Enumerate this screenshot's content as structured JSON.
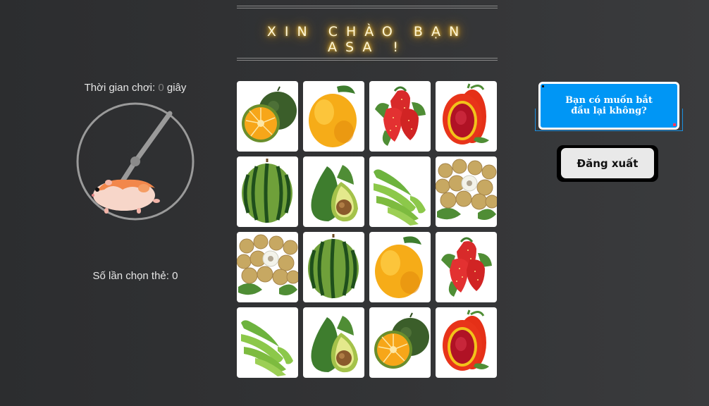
{
  "header": {
    "title": "XIN CHÀO BẠN ASA !"
  },
  "stats": {
    "timer_prefix": "Thời gian chơi: ",
    "timer_value": "0",
    "timer_unit": " giây",
    "clicks_prefix": "Số lần chọn thẻ: ",
    "clicks_value": "0"
  },
  "board": {
    "cards": [
      "orange-fruit-icon",
      "mango-fruit-icon",
      "strawberry-fruit-icon",
      "gac-fruit-icon",
      "watermelon-fruit-icon",
      "avocado-fruit-icon",
      "banana-fruit-icon",
      "longan-fruit-icon",
      "longan-fruit-icon",
      "watermelon-fruit-icon",
      "mango-fruit-icon",
      "strawberry-fruit-icon",
      "banana-fruit-icon",
      "avocado-fruit-icon",
      "orange-fruit-icon",
      "gac-fruit-icon"
    ]
  },
  "actions": {
    "restart_label": "Bạn có muốn bắt đầu lại không?",
    "logout_label": "Đăng xuất"
  },
  "colors": {
    "background": "#333436",
    "title_glow": "#ffb300",
    "restart_button": "#0096f5",
    "logout_button": "#e9e9e9"
  }
}
